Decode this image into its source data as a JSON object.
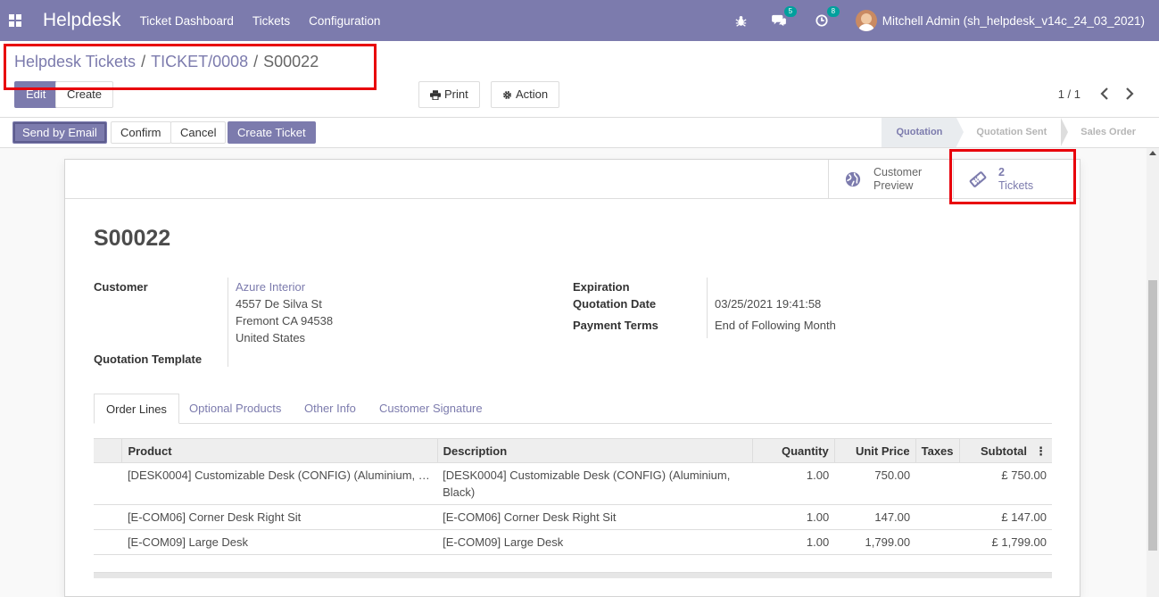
{
  "navbar": {
    "brand": "Helpdesk",
    "menu": [
      "Ticket Dashboard",
      "Tickets",
      "Configuration"
    ],
    "messages_count": "5",
    "activities_count": "8",
    "user": "Mitchell Admin (sh_helpdesk_v14c_24_03_2021)"
  },
  "breadcrumb": {
    "items": [
      "Helpdesk Tickets",
      "TICKET/0008"
    ],
    "separator": "/",
    "current": "S00022"
  },
  "control": {
    "edit": "Edit",
    "create": "Create",
    "print": "Print",
    "action": "Action",
    "pager": "1 / 1"
  },
  "statusbar": {
    "buttons": [
      "Send by Email",
      "Confirm",
      "Cancel",
      "Create Ticket"
    ],
    "stages": [
      "Quotation",
      "Quotation Sent",
      "Sales Order"
    ],
    "active_stage": "Quotation"
  },
  "smart_buttons": {
    "customer_preview": [
      "Customer",
      "Preview"
    ],
    "tickets_count": "2",
    "tickets_label": "Tickets"
  },
  "form": {
    "name": "S00022",
    "customer_label": "Customer",
    "customer_name": "Azure Interior",
    "customer_address": [
      "4557 De Silva St",
      "Fremont CA 94538",
      "United States"
    ],
    "quotation_template_label": "Quotation Template",
    "expiration_label": "Expiration",
    "quotation_date_label": "Quotation Date",
    "quotation_date": "03/25/2021 19:41:58",
    "payment_terms_label": "Payment Terms",
    "payment_terms": "End of Following Month"
  },
  "tabs": [
    "Order Lines",
    "Optional Products",
    "Other Info",
    "Customer Signature"
  ],
  "lines": {
    "headers": [
      "Product",
      "Description",
      "Quantity",
      "Unit Price",
      "Taxes",
      "Subtotal"
    ],
    "rows": [
      {
        "product": "[DESK0004] Customizable Desk (CONFIG) (Aluminium, …",
        "description": "[DESK0004] Customizable Desk (CONFIG) (Aluminium, Black)",
        "quantity": "1.00",
        "unit_price": "750.00",
        "taxes": "",
        "subtotal": "£ 750.00"
      },
      {
        "product": "[E-COM06] Corner Desk Right Sit",
        "description": "[E-COM06] Corner Desk Right Sit",
        "quantity": "1.00",
        "unit_price": "147.00",
        "taxes": "",
        "subtotal": "£ 147.00"
      },
      {
        "product": "[E-COM09] Large Desk",
        "description": "[E-COM09] Large Desk",
        "quantity": "1.00",
        "unit_price": "1,799.00",
        "taxes": "",
        "subtotal": "£ 1,799.00"
      }
    ]
  },
  "colors": {
    "brand": "#7c7bad",
    "highlight": "#e8000b",
    "badge": "#00a09d"
  }
}
